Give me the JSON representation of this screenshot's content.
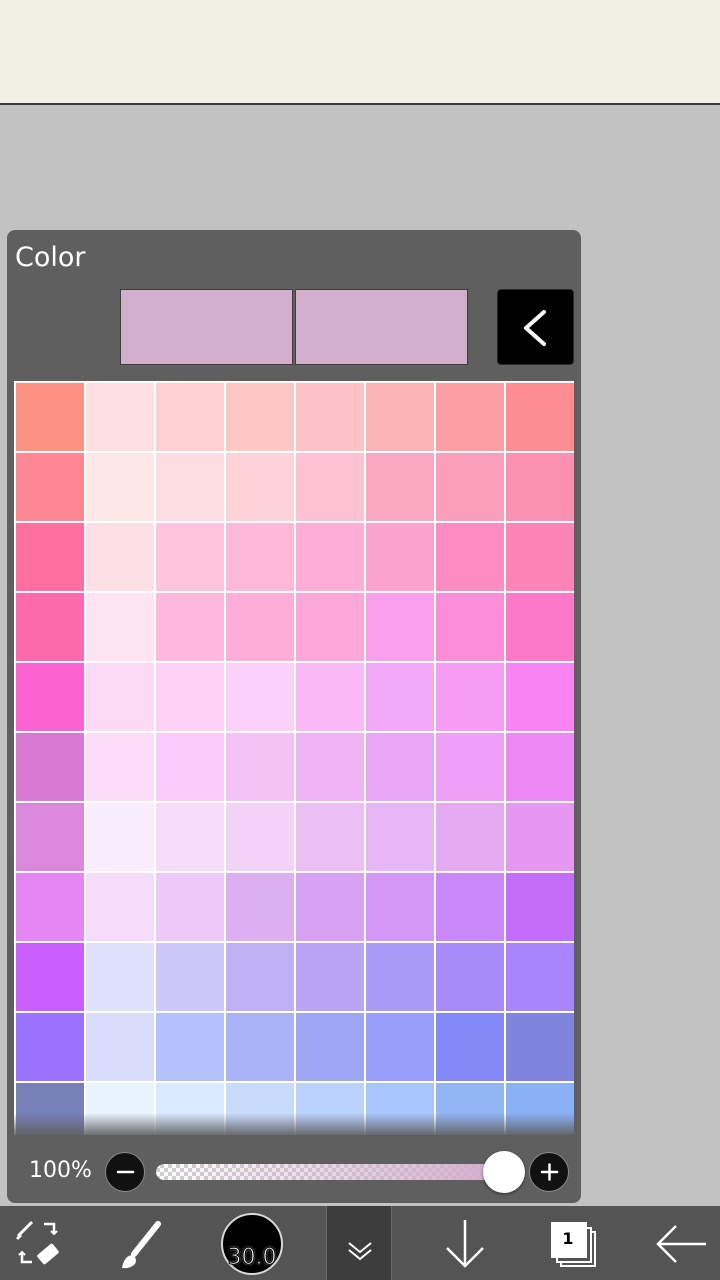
{
  "panel": {
    "title": "Color",
    "primary_color": "#d1aecc",
    "secondary_color": "#d1aecc"
  },
  "palette": {
    "visible_rows": 11,
    "columns": 8,
    "rows": [
      [
        "#fc9184",
        "#fee0e1",
        "#fdcfcf",
        "#fdc7c6",
        "#fdc1c6",
        "#fbb4b4",
        "#fc9fa5",
        "#fd8d90"
      ],
      [
        "#fd8793",
        "#fce8e7",
        "#fddde1",
        "#fed2d6",
        "#fec2d3",
        "#fba8c3",
        "#fb9eba",
        "#fc90b1"
      ],
      [
        "#fe6fa0",
        "#fddfe6",
        "#fec4dc",
        "#feb9d9",
        "#fdadd6",
        "#fba3cc",
        "#fc8cc2",
        "#fe83b6"
      ],
      [
        "#fd6aac",
        "#fee4f3",
        "#feb7dd",
        "#fdadd8",
        "#fda7d9",
        "#fa9eee",
        "#fb8ed9",
        "#fb77c7"
      ],
      [
        "#fc62d0",
        "#fcdaf5",
        "#fdd2f5",
        "#fbd0f9",
        "#f9b8f6",
        "#f1a8f6",
        "#f79cf5",
        "#f884f3"
      ],
      [
        "#d778d4",
        "#fbdcf8",
        "#f9cafa",
        "#f5c2f6",
        "#efb3f6",
        "#eaa6f6",
        "#ef9ff7",
        "#ed88f6"
      ],
      [
        "#d988db",
        "#f8ecfd",
        "#f6dbfa",
        "#f3d2f8",
        "#ebbff4",
        "#e6b5f5",
        "#e6aaf2",
        "#e598f2"
      ],
      [
        "#e686f5",
        "#f6dcfb",
        "#ecc9f9",
        "#dcaef2",
        "#d8a1f3",
        "#d497f8",
        "#c987f7",
        "#c46dfa"
      ],
      [
        "#cb5ffe",
        "#dfe0fa",
        "#cdc8f9",
        "#bfb0f3",
        "#b9a3f4",
        "#a99af8",
        "#a78cf9",
        "#a884fd"
      ],
      [
        "#9b72fd",
        "#d9ddfd",
        "#b3c2fa",
        "#aab3f8",
        "#9ea7f6",
        "#979ffa",
        "#8289f7",
        "#7f84dd"
      ],
      [
        "#7880b9",
        "#e7f3fd",
        "#d9eafe",
        "#c9dbfd",
        "#bbd2fd",
        "#a9c5fd",
        "#92b6f4",
        "#8ab0f6"
      ]
    ]
  },
  "opacity": {
    "label": "100%",
    "value": 1.0
  },
  "toolbar": {
    "brush_size": "30.0",
    "layer_count": "1"
  },
  "icons": {
    "collapse": "chevron-left-icon",
    "minus": "minus-icon",
    "plus": "plus-icon",
    "swap": "pen-eraser-swap-icon",
    "brush": "brush-icon",
    "menu": "double-chevron-down-icon",
    "download": "arrow-down-icon",
    "layers": "layers-icon",
    "back": "arrow-left-icon"
  }
}
